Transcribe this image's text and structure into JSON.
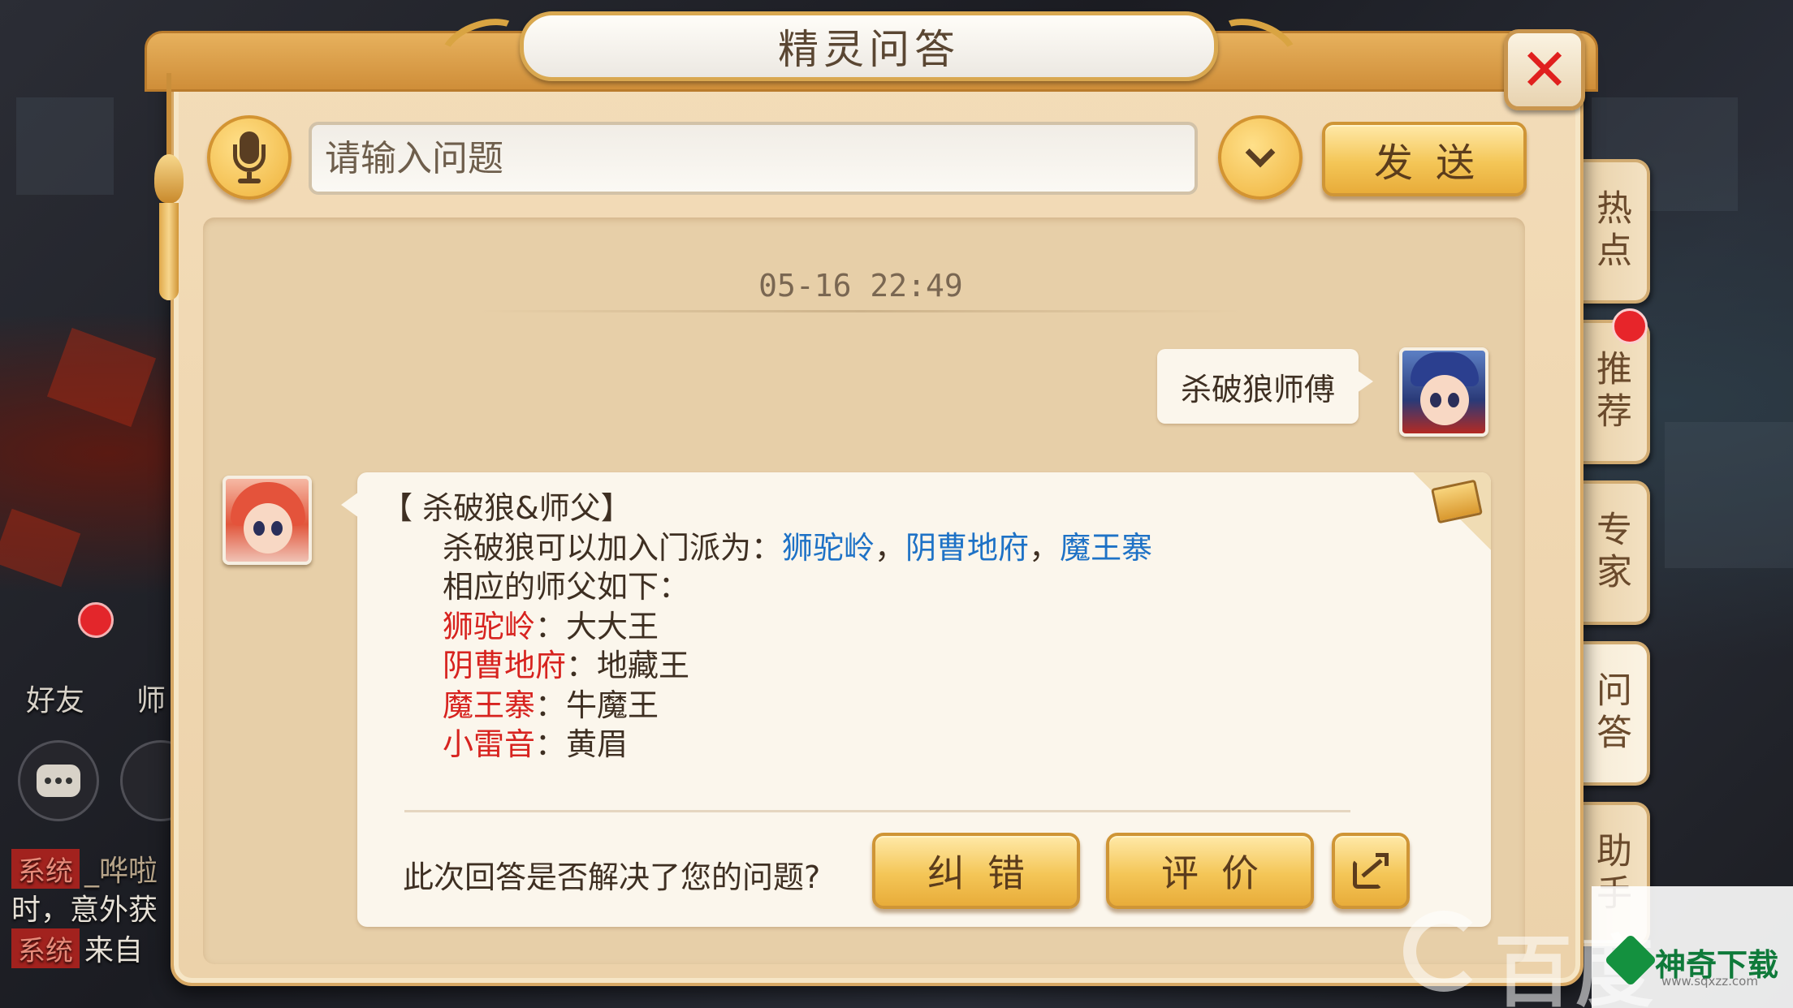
{
  "dialog": {
    "title": "精灵问答",
    "close_label": "✕"
  },
  "input_row": {
    "placeholder": "请输入问题",
    "send_label": "发送"
  },
  "chat": {
    "timestamp": "05-16 22:49",
    "user_message": "杀破狼师傅",
    "answer": {
      "heading": "【 杀破狼&师父】",
      "line1_prefix": "杀破狼可以加入门派为：",
      "sects": [
        "狮驼岭",
        "阴曹地府",
        "魔王寨"
      ],
      "separator": "，",
      "line2": "相应的师父如下：",
      "masters": [
        {
          "sect": "狮驼岭",
          "master": "大大王"
        },
        {
          "sect": "阴曹地府",
          "master": "地藏王"
        },
        {
          "sect": "魔王寨",
          "master": "牛魔王"
        },
        {
          "sect": "小雷音",
          "master": "黄眉"
        }
      ],
      "colon": "："
    },
    "feedback": {
      "question": "此次回答是否解决了您的问题?",
      "fix_label": "纠错",
      "rate_label": "评价"
    }
  },
  "side_tabs": [
    {
      "label": "热点"
    },
    {
      "label": "推荐"
    },
    {
      "label": "专家"
    },
    {
      "label": "问答"
    },
    {
      "label": "助手"
    }
  ],
  "hud": {
    "friends_label": "好友",
    "master_label": "师",
    "chat_lines": [
      {
        "tag": "系统",
        "name": "_哗啦",
        "text": ""
      },
      {
        "tag": "",
        "name": "",
        "text": "时，意外获"
      },
      {
        "tag": "系统",
        "name": "",
        "text": "来自"
      }
    ]
  },
  "watermarks": {
    "baidu": "百度",
    "brand": "神奇下载",
    "brand_url": "www.sqxzz.com"
  },
  "colors": {
    "link_blue": "#1e72c6",
    "sect_red": "#d7231f",
    "gold_button": "#f4c657",
    "close_red": "#e0201e"
  },
  "icons": {
    "mic": "microphone-icon",
    "dropdown": "chevron-down-icon",
    "share": "share-icon",
    "book": "book-icon",
    "close": "close-icon"
  }
}
